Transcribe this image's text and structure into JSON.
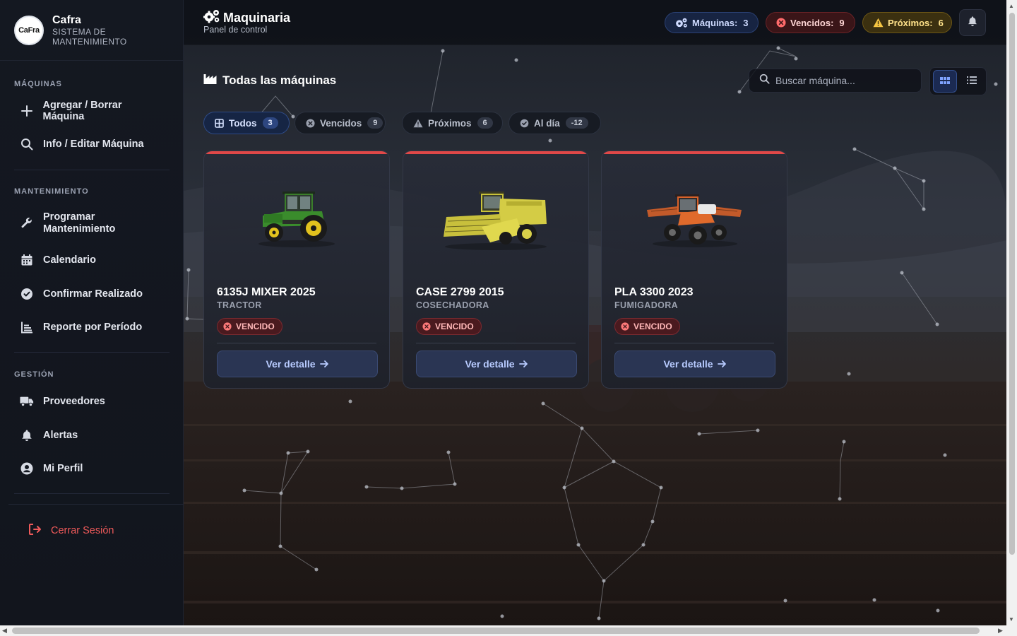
{
  "brand": {
    "logo_text": "CaFra",
    "name": "Cafra",
    "subtitle": "SISTEMA DE MANTENIMIENTO"
  },
  "sidebar": {
    "sections": [
      {
        "title": "MÁQUINAS",
        "items": [
          {
            "label": "Agregar / Borrar Máquina",
            "icon": "plus-icon"
          },
          {
            "label": "Info / Editar Máquina",
            "icon": "search-icon"
          }
        ]
      },
      {
        "title": "MANTENIMIENTO",
        "items": [
          {
            "label": "Programar Mantenimiento",
            "icon": "wrench-icon"
          },
          {
            "label": "Calendario",
            "icon": "calendar-icon"
          },
          {
            "label": "Confirmar Realizado",
            "icon": "check-circle-icon"
          },
          {
            "label": "Reporte por Período",
            "icon": "chart-icon"
          }
        ]
      },
      {
        "title": "GESTIÓN",
        "items": [
          {
            "label": "Proveedores",
            "icon": "truck-icon"
          },
          {
            "label": "Alertas",
            "icon": "bell-icon"
          },
          {
            "label": "Mi Perfil",
            "icon": "user-circle-icon"
          }
        ]
      }
    ],
    "logout_label": "Cerrar Sesión"
  },
  "header": {
    "title": "Maquinaria",
    "subtitle": "Panel de control",
    "stats": {
      "machines": {
        "label": "Máquinas:",
        "value": "3"
      },
      "expired": {
        "label": "Vencidos:",
        "value": "9"
      },
      "upcoming": {
        "label": "Próximos:",
        "value": "6"
      }
    }
  },
  "main": {
    "section_title": "Todas las máquinas",
    "search_placeholder": "Buscar máquina...",
    "filters": [
      {
        "label": "Todos",
        "count": "3"
      },
      {
        "label": "Vencidos",
        "count": "9"
      },
      {
        "label": "Próximos",
        "count": "6"
      },
      {
        "label": "Al día",
        "count": "-12"
      }
    ],
    "machines": [
      {
        "name": "6135J MIXER 2025",
        "type": "TRACTOR",
        "status": "VENCIDO",
        "action": "Ver detalle"
      },
      {
        "name": "CASE 2799 2015",
        "type": "COSECHADORA",
        "status": "VENCIDO",
        "action": "Ver detalle"
      },
      {
        "name": "PLA 3300 2023",
        "type": "FUMIGADORA",
        "status": "VENCIDO",
        "action": "Ver detalle"
      }
    ]
  },
  "colors": {
    "accent": "#3b5bdb",
    "danger": "#e04848",
    "warning": "#f2c230",
    "sidebar_bg": "#141821"
  }
}
